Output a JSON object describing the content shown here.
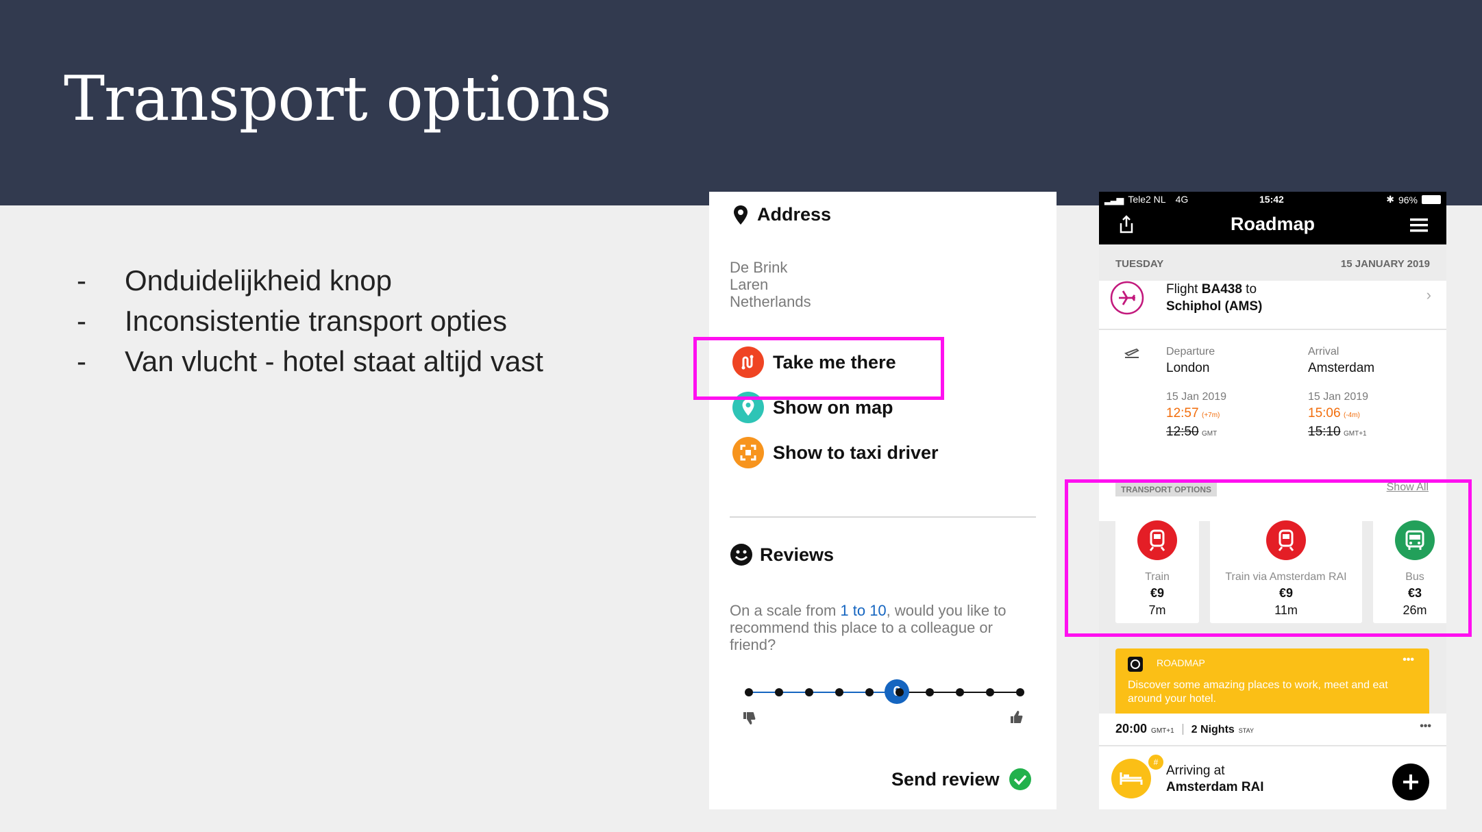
{
  "slide": {
    "title": "Transport options",
    "bullets": [
      {
        "dash": "-",
        "text": "Onduidelijkheid knop"
      },
      {
        "dash": "-",
        "text": "Inconsistentie transport opties"
      },
      {
        "dash": "-",
        "text": "Van vlucht - hotel staat altijd vast"
      }
    ]
  },
  "left_panel": {
    "address_title": "Address",
    "address_lines": [
      "De Brink",
      "Laren",
      "Netherlands"
    ],
    "actions": [
      {
        "label": "Take me there",
        "icon": "route-icon",
        "color": "#ef4423"
      },
      {
        "label": "Show on map",
        "icon": "map-pin-icon",
        "color": "#2ec4b6"
      },
      {
        "label": "Show to taxi driver",
        "icon": "fullscreen-icon",
        "color": "#f7941d"
      }
    ],
    "reviews_title": "Reviews",
    "question_pre": "On a scale from ",
    "question_range": "1 to 10",
    "question_post": ", would you like to recommend this place to a colleague or friend?",
    "slider_value": "6",
    "send_review": "Send review"
  },
  "right_panel": {
    "status": {
      "carrier": "Tele2 NL",
      "network": "4G",
      "time": "15:42",
      "battery": "96%"
    },
    "nav_title": "Roadmap",
    "day": "TUESDAY",
    "date": "15 JANUARY 2019",
    "flight": {
      "prefix": "Flight ",
      "code": "BA438",
      "suffix": " to",
      "destination": "Schiphol (AMS)"
    },
    "departure": {
      "label": "Departure",
      "city": "London",
      "date": "15 Jan 2019",
      "new_time": "12:57",
      "delay": "(+7m)",
      "old_time": "12:50",
      "tz": "GMT"
    },
    "arrival": {
      "label": "Arrival",
      "city": "Amsterdam",
      "date": "15 Jan 2019",
      "new_time": "15:06",
      "delay": "(-4m)",
      "old_time": "15:10",
      "tz": "GMT+1"
    },
    "transport_header": "TRANSPORT OPTIONS",
    "show_all": "Show All",
    "transport": [
      {
        "name": "Train",
        "price": "€9",
        "duration": "7m",
        "icon": "train-icon",
        "color": "#e41e26"
      },
      {
        "name": "Train via Amsterdam RAI",
        "price": "€9",
        "duration": "11m",
        "icon": "train-icon",
        "color": "#e41e26"
      },
      {
        "name": "Bus",
        "price": "€3",
        "duration": "26m",
        "icon": "bus-icon",
        "color": "#22a05a"
      }
    ],
    "promo": {
      "label": "ROADMAP",
      "menu": "•••",
      "text": "Discover some amazing places to work, meet and eat around your hotel."
    },
    "stay": {
      "time": "20:00",
      "tz": "GMT+1",
      "nights": "2 Nights",
      "stay_label": "STAY",
      "menu": "•••"
    },
    "arriving": {
      "line1": "Arriving at",
      "line2": "Amsterdam RAI"
    }
  }
}
